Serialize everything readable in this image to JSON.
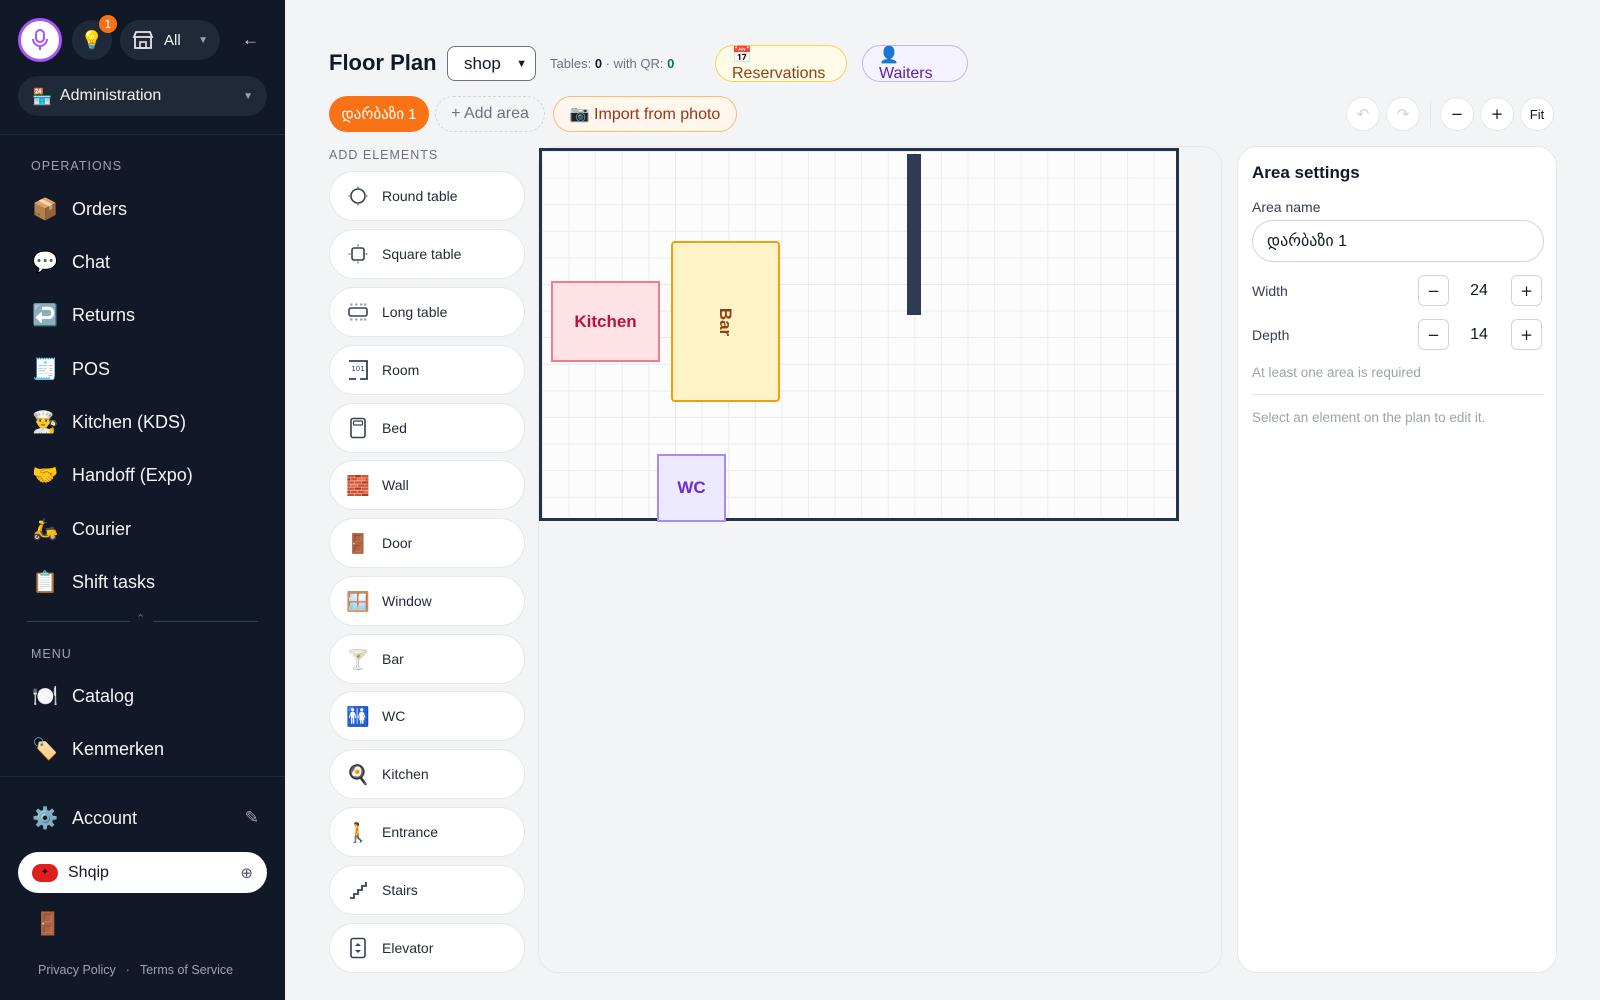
{
  "header_left": {
    "bulb_badge": "1",
    "store_selector": "All",
    "admin_selector": "Administration"
  },
  "sidebar": {
    "operations_label": "OPERATIONS",
    "operations": [
      {
        "icon": "📦",
        "label": "Orders"
      },
      {
        "icon": "💬",
        "label": "Chat"
      },
      {
        "icon": "↩️",
        "label": "Returns"
      },
      {
        "icon": "🧾",
        "label": "POS"
      },
      {
        "icon": "👨‍🍳",
        "label": "Kitchen (KDS)"
      },
      {
        "icon": "🤝",
        "label": "Handoff (Expo)"
      },
      {
        "icon": "🛵",
        "label": "Courier"
      },
      {
        "icon": "📋",
        "label": "Shift tasks"
      }
    ],
    "menu_label": "MENU",
    "menu": [
      {
        "icon": "🍽️",
        "label": "Catalog"
      },
      {
        "icon": "🏷️",
        "label": "Kenmerken"
      }
    ],
    "account": {
      "icon": "⚙️",
      "label": "Account"
    },
    "language": "Shqip",
    "footer": {
      "privacy": "Privacy Policy",
      "sep": "·",
      "terms": "Terms of Service"
    }
  },
  "header": {
    "title": "Floor Plan",
    "shop_select": "shop",
    "tables_prefix": "Tables: ",
    "tables_count": "0",
    "qr_prefix": " · with QR: ",
    "qr_count": "0",
    "reservations": "📅 Reservations",
    "waiters": "👤 Waiters"
  },
  "areas": {
    "active_tab": "დარბაზი 1",
    "add_area": "+ Add area",
    "import_photo": "📷 Import from photo"
  },
  "toolbar": {
    "undo": "↶",
    "redo": "↷",
    "zoom_out": "−",
    "zoom_in": "+",
    "fit": "Fit"
  },
  "palette": {
    "label": "ADD ELEMENTS",
    "items": [
      {
        "icon": "round-table-icon",
        "label": "Round table"
      },
      {
        "icon": "square-table-icon",
        "label": "Square table"
      },
      {
        "icon": "long-table-icon",
        "label": "Long table"
      },
      {
        "icon": "room-icon",
        "label": "Room"
      },
      {
        "icon": "bed-icon",
        "label": "Bed"
      },
      {
        "icon": "🧱",
        "label": "Wall"
      },
      {
        "icon": "🚪",
        "label": "Door"
      },
      {
        "icon": "🪟",
        "label": "Window"
      },
      {
        "icon": "🍸",
        "label": "Bar"
      },
      {
        "icon": "🚻",
        "label": "WC"
      },
      {
        "icon": "🍳",
        "label": "Kitchen"
      },
      {
        "icon": "🚶",
        "label": "Entrance"
      },
      {
        "icon": "stairs-icon",
        "label": "Stairs"
      },
      {
        "icon": "elevator-icon",
        "label": "Elevator"
      }
    ]
  },
  "plan": {
    "kitchen": "Kitchen",
    "bar": "Bar",
    "wc": "WC"
  },
  "settings": {
    "title": "Area settings",
    "area_name_label": "Area name",
    "area_name_value": "დარბაზი 1",
    "width_label": "Width",
    "width_value": "24",
    "depth_label": "Depth",
    "depth_value": "14",
    "minus": "−",
    "plus": "+",
    "required_hint": "At least one area is required",
    "select_hint": "Select an element on the plan to edit it."
  }
}
